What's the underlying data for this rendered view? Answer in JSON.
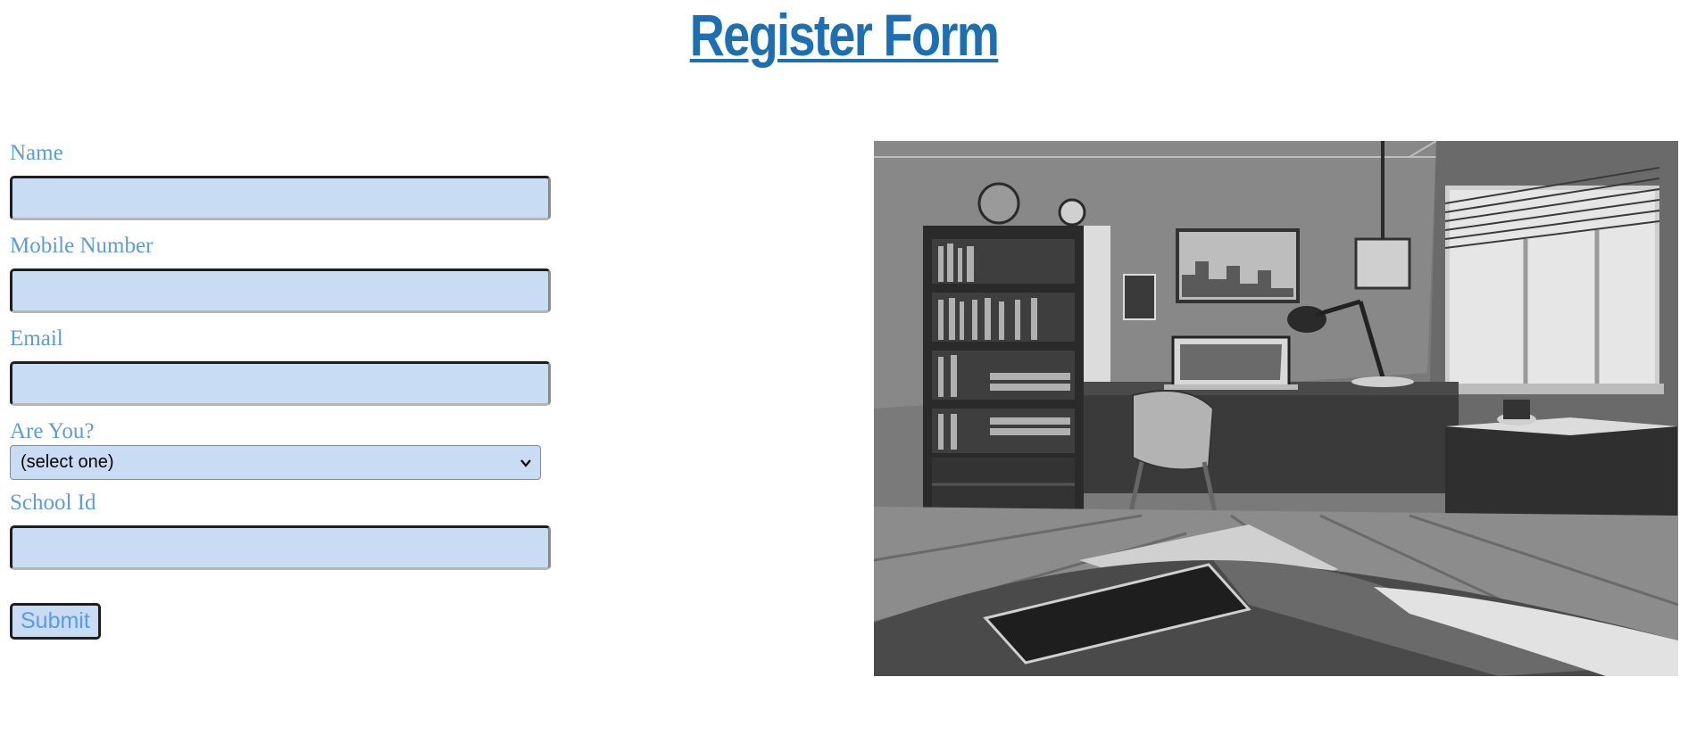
{
  "page": {
    "title": "Register Form"
  },
  "form": {
    "fields": {
      "name": {
        "label": "Name",
        "value": ""
      },
      "mobile": {
        "label": "Mobile Number",
        "value": ""
      },
      "email": {
        "label": "Email",
        "value": ""
      },
      "role": {
        "label": "Are You?",
        "selected": "(select one)"
      },
      "school_id": {
        "label": "School Id",
        "value": ""
      }
    },
    "submit_label": "Submit"
  },
  "illustration": {
    "subject": "grayscale study room with bookshelf, desk, laptop, lamp, chair, window and bed"
  },
  "colors": {
    "title": "#1a6fb5",
    "label": "#5b9be0",
    "input_bg": "#c8dcf3"
  }
}
